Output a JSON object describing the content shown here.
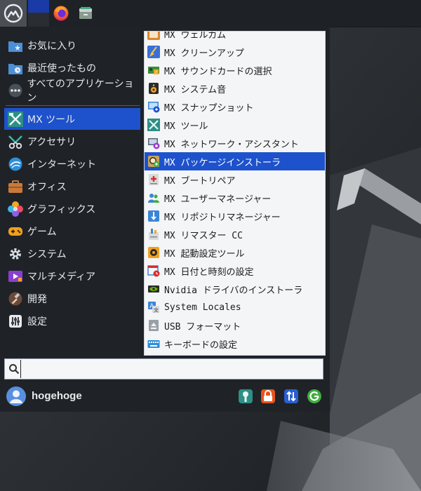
{
  "panel": {
    "icons": [
      "mx-logo-icon",
      "workspace-switcher",
      "firefox-icon",
      "file-manager-icon"
    ]
  },
  "categories": [
    {
      "label": "お気に入り",
      "icon": "favorites-folder-icon"
    },
    {
      "label": "最近使ったもの",
      "icon": "recent-folder-icon"
    },
    {
      "label": "すべてのアプリケーション",
      "icon": "all-apps-icon"
    },
    {
      "label": "MX ツール",
      "icon": "mx-tools-icon",
      "selected": true
    },
    {
      "label": "アクセサリ",
      "icon": "accessories-icon"
    },
    {
      "label": "インターネット",
      "icon": "internet-icon"
    },
    {
      "label": "オフィス",
      "icon": "office-icon"
    },
    {
      "label": "グラフィックス",
      "icon": "graphics-icon"
    },
    {
      "label": "ゲーム",
      "icon": "games-icon"
    },
    {
      "label": "システム",
      "icon": "system-icon"
    },
    {
      "label": "マルチメディア",
      "icon": "multimedia-icon"
    },
    {
      "label": "開発",
      "icon": "development-icon"
    },
    {
      "label": "設定",
      "icon": "settings-icon"
    }
  ],
  "apps": [
    {
      "label": "MX ウェルカム",
      "icon": "welcome-icon"
    },
    {
      "label": "MX クリーンアップ",
      "icon": "cleanup-broom-icon"
    },
    {
      "label": "MX サウンドカードの選択",
      "icon": "soundcard-icon"
    },
    {
      "label": "MX システム音",
      "icon": "speaker-icon"
    },
    {
      "label": "MX スナップショット",
      "icon": "snapshot-icon"
    },
    {
      "label": "MX ツール",
      "icon": "mx-tools-icon"
    },
    {
      "label": "MX ネットワーク・アシスタント",
      "icon": "network-icon"
    },
    {
      "label": "MX パッケージインストーラ",
      "icon": "package-installer-icon",
      "selected": true
    },
    {
      "label": "MX ブートリペア",
      "icon": "boot-repair-icon"
    },
    {
      "label": "MX ユーザーマネージャー",
      "icon": "user-manager-icon"
    },
    {
      "label": "MX リポジトリマネージャー",
      "icon": "repo-manager-icon"
    },
    {
      "label": "MX リマスター CC",
      "icon": "remaster-icon"
    },
    {
      "label": "MX 起動設定ツール",
      "icon": "boot-options-icon"
    },
    {
      "label": "MX 日付と時刻の設定",
      "icon": "date-time-icon"
    },
    {
      "label": "Nvidia ドライバのインストーラ",
      "icon": "nvidia-icon"
    },
    {
      "label": "System Locales",
      "icon": "locales-icon"
    },
    {
      "label": "USB フォーマット",
      "icon": "usb-format-icon"
    },
    {
      "label": "キーボードの設定",
      "icon": "keyboard-icon"
    }
  ],
  "search": {
    "value": "",
    "placeholder": ""
  },
  "footer": {
    "username": "hogehoge",
    "actions": [
      "settings-manager-icon",
      "lock-screen-icon",
      "switch-user-icon",
      "logout-icon"
    ]
  },
  "colors": {
    "accent": "#1e52cc",
    "menu_bg": "#1f2327",
    "list_bg": "#f4f5f6"
  }
}
